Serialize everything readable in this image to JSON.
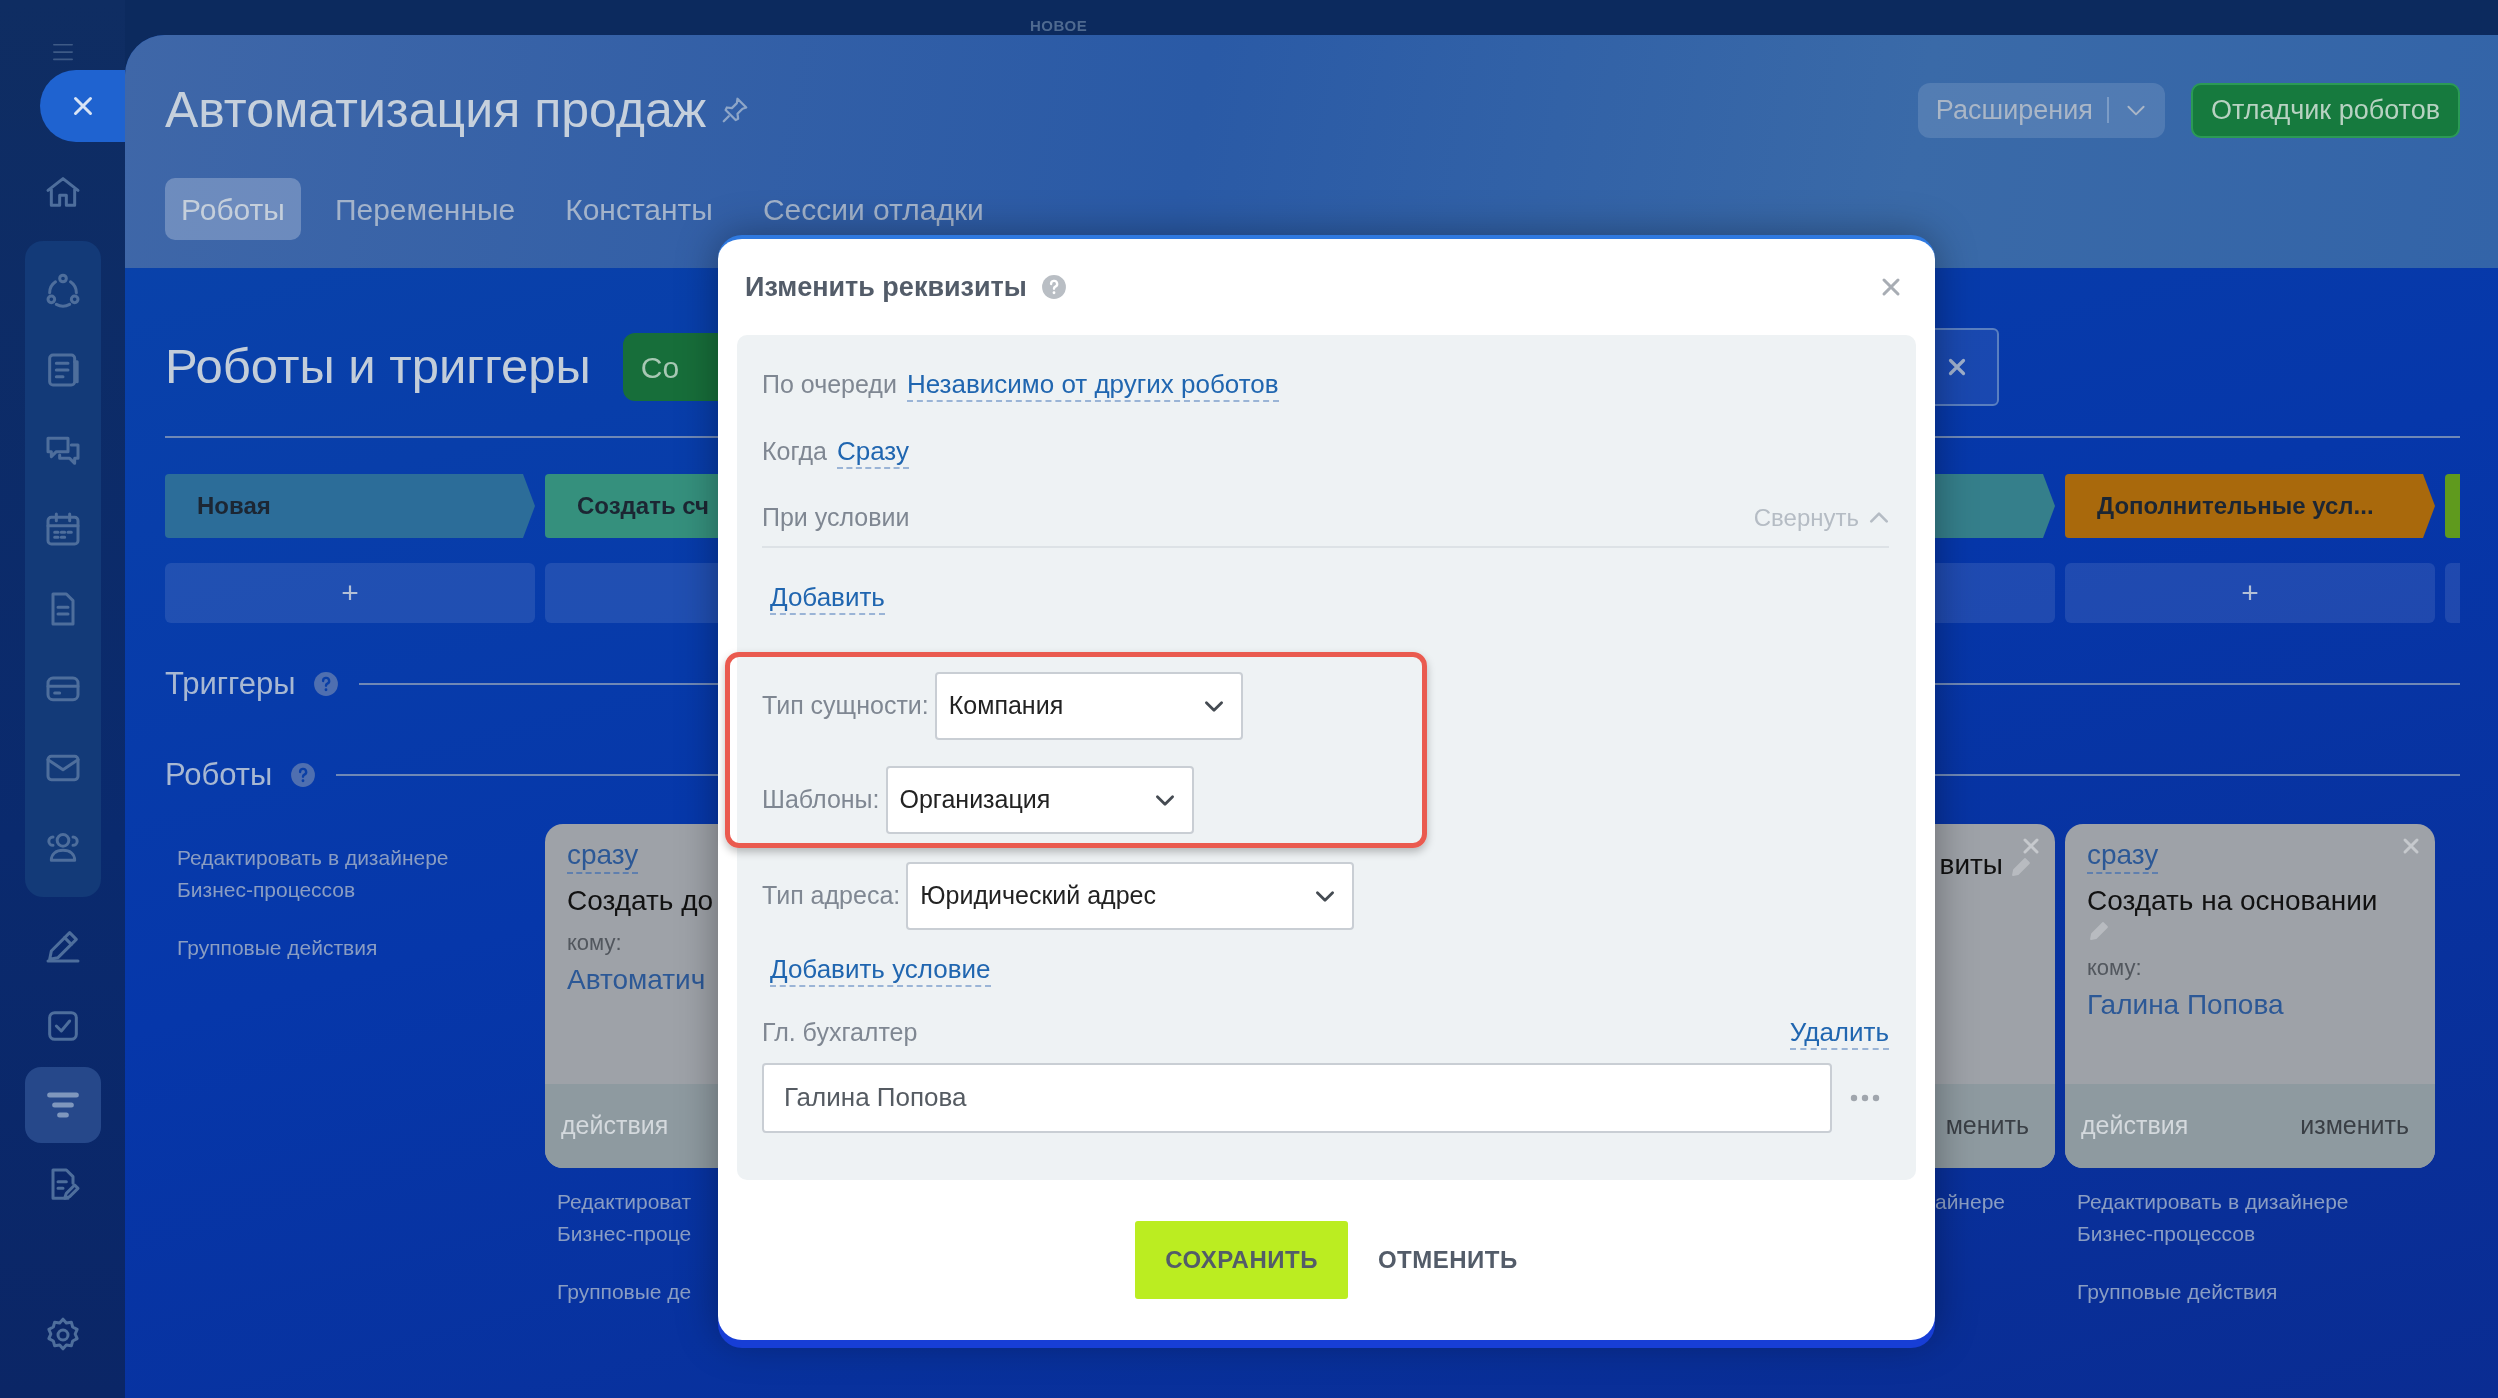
{
  "top_label": "НОВОЕ",
  "sidebar": {
    "top_items": [
      {
        "selected": false
      }
    ],
    "group_items": [
      {
        "selected": false
      },
      {
        "selected": false
      },
      {
        "selected": false
      },
      {
        "selected": false
      },
      {
        "selected": false
      },
      {
        "selected": false
      },
      {
        "selected": false
      },
      {
        "selected": false
      }
    ],
    "items": [
      {
        "selected": false
      },
      {
        "selected": false
      },
      {
        "selected": true
      },
      {
        "selected": false
      }
    ],
    "bottom_items": [
      {
        "selected": false
      }
    ]
  },
  "header": {
    "title": "Автоматизация продаж",
    "tabs": [
      {
        "label": "Роботы",
        "selected": true
      },
      {
        "label": "Переменные",
        "selected": false
      },
      {
        "label": "Константы",
        "selected": false
      },
      {
        "label": "Сессии отладки",
        "selected": false
      }
    ],
    "extensions_button": "Расширения",
    "debugger_button": "Отладчик роботов"
  },
  "board": {
    "title": "Роботы и триггеры",
    "create_button": "Со",
    "stages": [
      {
        "label": "Новая",
        "color": "#2c6d99",
        "add": "+"
      },
      {
        "label": "Создать сч",
        "color": "#35907d"
      },
      {
        "color": "#357f8b"
      },
      {
        "label": "Дополнительные усл...",
        "color": "#a9690c",
        "add": "+"
      },
      {
        "color": "#5f9a1e"
      }
    ],
    "triggers_title": "Триггеры",
    "robots_title": "Роботы",
    "side_links": [
      {
        "lines": [
          "Редактировать в дизайнере",
          "Бизнес-процессов"
        ]
      },
      {
        "lines": [
          "Групповые действия"
        ]
      }
    ],
    "cards": [
      {
        "when": "сразу",
        "title": "Создать до",
        "to_label": "кому:",
        "to": "Автоматич",
        "footer_left": "действия",
        "links": [
          {
            "lines": [
              "Редактироват",
              "Бизнес-проце"
            ]
          },
          {
            "lines": [
              "Групповые де"
            ]
          }
        ]
      },
      {
        "title": "виты",
        "footer_right": "менить",
        "links": [
          {
            "lines": [
              "айнере"
            ]
          }
        ]
      },
      {
        "when": "сразу",
        "title": "Создать на основании",
        "to_label": "кому:",
        "to": "Галина Попова",
        "footer_left": "действия",
        "footer_right": "изменить",
        "links": [
          {
            "lines": [
              "Редактировать в дизайнере",
              "Бизнес-процессов"
            ]
          },
          {
            "lines": [
              "Групповые действия"
            ]
          }
        ]
      }
    ]
  },
  "modal": {
    "title": "Изменить реквизиты",
    "rows": [
      {
        "label": "По очереди",
        "link": "Независимо от других роботов"
      },
      {
        "label": "Когда",
        "link": "Сразу"
      }
    ],
    "condition": {
      "label": "При условии",
      "collapse": "Свернуть",
      "add_link": "Добавить"
    },
    "highlighted_fields": [
      {
        "label": "Тип сущности:",
        "value": "Компания"
      },
      {
        "label": "Шаблоны:",
        "value": "Организация"
      }
    ],
    "fields": [
      {
        "label": "Тип адреса:",
        "value": "Юридический адрес"
      }
    ],
    "add_condition": "Добавить условие",
    "accountant": {
      "label": "Гл. бухгалтер",
      "delete": "Удалить",
      "value": "Галина Попова"
    },
    "save_button": "СОХРАНИТЬ",
    "cancel_button": "ОТМЕНИТЬ"
  }
}
